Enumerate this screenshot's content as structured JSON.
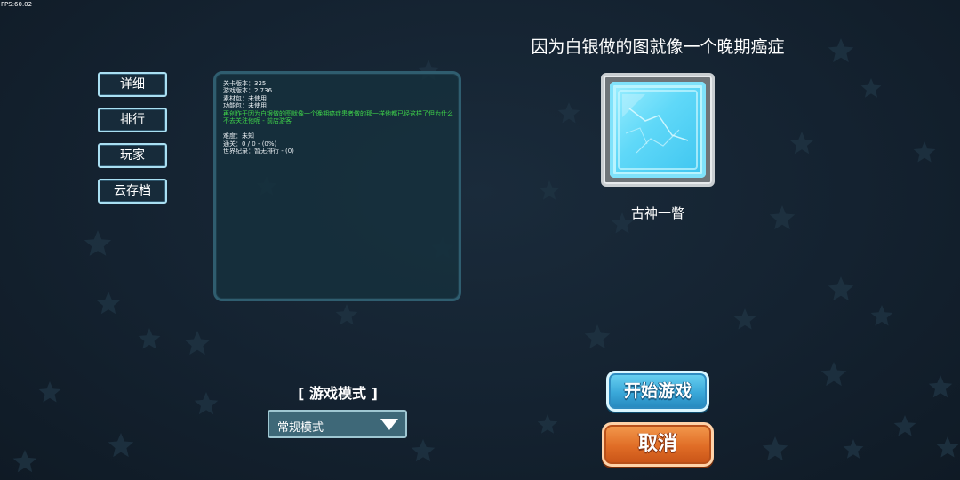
{
  "fps_text": "FPS:60.02",
  "side_menu": {
    "details": "详细",
    "ranking": "排行",
    "players": "玩家",
    "cloud_save": "云存档"
  },
  "info_panel": {
    "level_version": "关卡版本：325",
    "game_version": "游戏版本：2.736",
    "asset_pack": "素材包：未使用",
    "feature_pack": "功能包：未使用",
    "description": "再创作于因为白银做的图就像一个晚期癌症患者做的那一样他都已经这样了但为什么不去关注他呢 - 前店游客",
    "difficulty": "难度：未知",
    "clears": "通关：0 / 0 - (0%)",
    "world_record": "世界纪录：暂无排行 - (0)"
  },
  "level": {
    "title": "因为白银做的图就像一个晚期癌症",
    "thumbnail_icon": "ice-block-icon",
    "author": "古神一瞥"
  },
  "mode": {
    "label": "[ 游戏模式 ]",
    "selected": "常规模式"
  },
  "buttons": {
    "start": "开始游戏",
    "cancel": "取消"
  },
  "colors": {
    "background": "#142230",
    "panel_border": "#2f5d6f",
    "description_text": "#3fd44a",
    "start_button": "#3aa8d9",
    "cancel_button": "#e06d26"
  }
}
